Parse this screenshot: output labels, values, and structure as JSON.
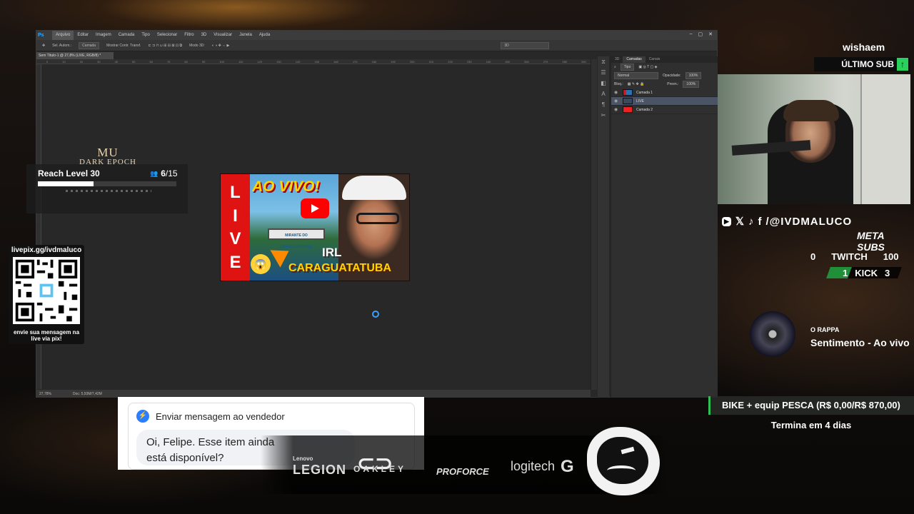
{
  "photoshop": {
    "logo": "Ps",
    "menu": [
      "Arquivo",
      "Editar",
      "Imagem",
      "Camada",
      "Tipo",
      "Selecionar",
      "Filtro",
      "3D",
      "Visualizar",
      "Janela",
      "Ajuda"
    ],
    "window_controls": [
      "–",
      "▢",
      "✕"
    ],
    "options": [
      "Sel. Autom.:",
      "Camada",
      "Mostrar Contr. Transf.",
      "Modo 3D:",
      "3D"
    ],
    "doc_tab": "Sem Título-1 @ 27,8% (LIVE, RGB/8) *",
    "ruler_ticks": [
      "0",
      "10",
      "20",
      "30",
      "40",
      "50",
      "60",
      "70",
      "80",
      "90",
      "100",
      "110",
      "120",
      "130",
      "140",
      "150",
      "160",
      "170",
      "180",
      "190",
      "200",
      "210",
      "220",
      "230",
      "240",
      "250",
      "260",
      "270",
      "280",
      "290",
      "300",
      "310",
      "320"
    ],
    "status_zoom": "27,78%",
    "status_doc": "Doc: 5,93M/7,42M",
    "panel_tabs": [
      "3D",
      "Camadas",
      "Canais"
    ],
    "filter_kind": "Tipo",
    "blend_mode": "Normal",
    "opacity_label": "Opacidade:",
    "opacity_value": "100%",
    "lock_label": "Bloq.:",
    "fill_label": "Preen.:",
    "fill_value": "100%",
    "layers": [
      {
        "name": "Camada 1",
        "selected": false
      },
      {
        "name": "LIVE",
        "selected": true
      },
      {
        "name": "Camada 2",
        "selected": false
      }
    ]
  },
  "thumbnail": {
    "live_letters": [
      "L",
      "I",
      "V",
      "E"
    ],
    "headline": "AO VIVO!",
    "sign": "MIRANTE DO CARAGUATATUBA",
    "irl": "IRL",
    "city": "CARAGUATATUBA",
    "emoji": "😱"
  },
  "mu_widget": {
    "logo_line1": "MU",
    "logo_line2": "DARK EPOCH",
    "task": "Reach Level 30",
    "progress_current": "6",
    "progress_total": "/15",
    "progress_fraction": 0.4
  },
  "qr": {
    "url": "livepix.gg/ivdmaluco",
    "caption": "envie sua mensagem na live via pix!"
  },
  "subscriber": {
    "name": "wishaem",
    "label": "ÚLTIMO SUB",
    "arrow": "↑"
  },
  "socials": {
    "icons": [
      "youtube-icon",
      "x-icon",
      "tiktok-icon",
      "facebook-icon"
    ],
    "handle": "/@IVDMALUCO"
  },
  "sub_goals": {
    "title": "META SUBS",
    "twitch_current": "0",
    "twitch_label": "TWITCH",
    "twitch_goal": "100",
    "kick_current": "1",
    "kick_label": "KICK",
    "kick_goal": "3"
  },
  "now_playing": {
    "artist": "O RAPPA",
    "track": "Sentimento - Ao vivo"
  },
  "donation_goal": {
    "title": "BIKE + equip PESCA (R$ 0,00/R$ 870,00)",
    "subtitle": "Termina em 4 dias"
  },
  "messenger": {
    "title": "Enviar mensagem ao vendedor",
    "message": "Oi, Felipe. Esse item ainda está disponível?"
  },
  "sponsors": {
    "lenovo": "Lenovo",
    "legion": "LEGION",
    "oakley": "OAKLEY",
    "proforce": "PROFORCE",
    "logitech": "logitech",
    "logitech_g": "G"
  }
}
